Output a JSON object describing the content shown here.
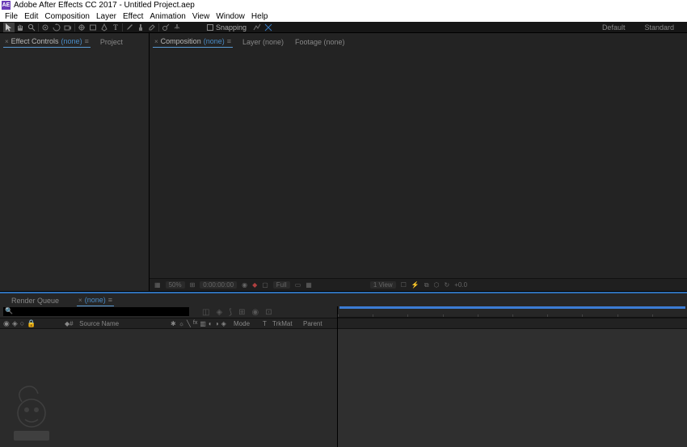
{
  "titlebar": {
    "app_badge": "AE",
    "title": "Adobe After Effects CC 2017 - Untitled Project.aep"
  },
  "menubar": [
    "File",
    "Edit",
    "Composition",
    "Layer",
    "Effect",
    "Animation",
    "View",
    "Window",
    "Help"
  ],
  "toolbar": {
    "snapping_label": "Snapping",
    "workspace_default": "Default",
    "workspace_standard": "Standard"
  },
  "left_panel": {
    "tab_effect_controls": "Effect Controls",
    "effect_controls_none": "(none)",
    "tab_project": "Project"
  },
  "right_panel": {
    "tab_composition": "Composition",
    "composition_none": "(none)",
    "tab_layer": "Layer (none)",
    "tab_footage": "Footage (none)"
  },
  "viewer_footer": {
    "zoom": "50%",
    "timecode": "0:00:00:00",
    "quality": "Full",
    "view": "1 View",
    "exposure": "+0.0"
  },
  "lower": {
    "tab_render_queue": "Render Queue",
    "tab_none": "(none)",
    "columns": {
      "hash": "#",
      "source_name": "Source Name",
      "mode": "Mode",
      "t": "T",
      "trkmat": "TrkMat",
      "parent": "Parent"
    },
    "search_placeholder": ""
  }
}
